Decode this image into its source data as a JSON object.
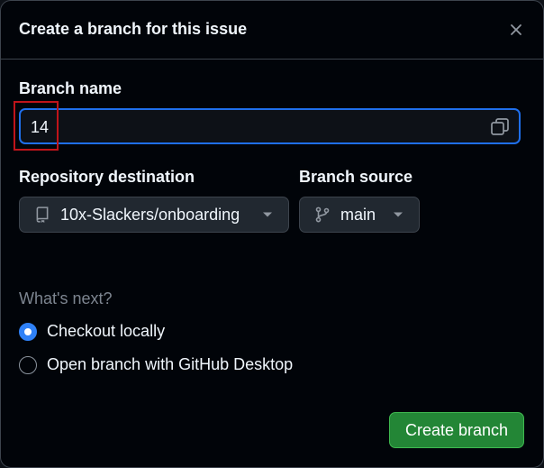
{
  "dialog": {
    "title": "Create a branch for this issue",
    "close_icon": "x-icon"
  },
  "branch_name": {
    "label": "Branch name",
    "value": "14",
    "copy_icon": "copy-icon"
  },
  "repository": {
    "label": "Repository destination",
    "value": "10x-Slackers/onboarding",
    "icon": "repo-icon"
  },
  "branch_source": {
    "label": "Branch source",
    "value": "main",
    "icon": "git-branch-icon"
  },
  "whats_next": {
    "label": "What's next?",
    "options": [
      {
        "label": "Checkout locally",
        "checked": true
      },
      {
        "label": "Open branch with GitHub Desktop",
        "checked": false
      }
    ]
  },
  "actions": {
    "create_label": "Create branch"
  },
  "colors": {
    "accent": "#1f6feb",
    "primary_button": "#238636",
    "highlight_box": "#c0141a"
  }
}
